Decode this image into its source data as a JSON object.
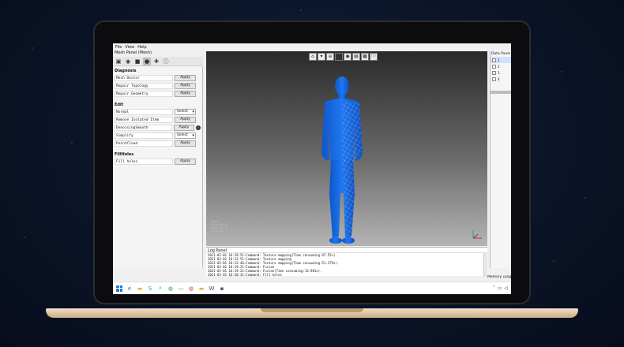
{
  "menubar": {
    "items": [
      "File",
      "View",
      "Help"
    ]
  },
  "left_panel": {
    "title": "Mesh Panel (Mesh)",
    "tools": [
      {
        "icon": "cube-icon",
        "active": false
      },
      {
        "icon": "eye-icon",
        "active": false
      },
      {
        "icon": "box-icon",
        "active": false
      },
      {
        "icon": "sphere-icon",
        "active": true
      },
      {
        "icon": "puzzle-icon",
        "active": false
      },
      {
        "icon": "info-icon",
        "active": false
      }
    ],
    "sections": [
      {
        "title": "Diagnosis",
        "rows": [
          {
            "label": "Mesh Doctor",
            "control": "button",
            "value": "Apply"
          },
          {
            "label": "Repair Topology",
            "control": "button",
            "value": "Apply"
          },
          {
            "label": "Repair Geometry",
            "control": "button",
            "value": "Apply"
          }
        ]
      },
      {
        "title": "Edit",
        "rows": [
          {
            "label": "Normal",
            "control": "select",
            "value": "Select"
          },
          {
            "label": "Remove Isolated Item",
            "control": "button",
            "value": "Apply"
          },
          {
            "label": "DenoisingSmooth",
            "control": "button",
            "value": "Apply",
            "info": true
          },
          {
            "label": "Simplify",
            "control": "select",
            "value": "Select"
          },
          {
            "label": "PointCloud",
            "control": "button",
            "value": "Apply"
          }
        ]
      },
      {
        "title": "FillHoles",
        "rows": [
          {
            "label": "Fill holes",
            "control": "button",
            "value": "Apply"
          }
        ]
      }
    ]
  },
  "viewport": {
    "toolbar": [
      {
        "icon": "home-icon"
      },
      {
        "icon": "arrow-down-icon"
      },
      {
        "icon": "layers-icon"
      },
      {
        "icon": "dark-square-icon"
      },
      {
        "icon": "eye-icon"
      },
      {
        "icon": "book-icon"
      },
      {
        "icon": "stack-icon"
      },
      {
        "icon": "info-icon"
      }
    ],
    "info_lines": [
      "Mesh0 :",
      "Faces 64 9K",
      "Verts 135 1K",
      "Textured"
    ]
  },
  "log_panel": {
    "title": "Log Panel",
    "lines": [
      "2021-02-01 16:19:51:Command: Texture mapping(Time consuming:47.55s).",
      "2021-02-01 16:12:51:Command: Texture mapping",
      "2021-02-01 16:12:46:Command: Texture mapping(Time consuming:51.279s).",
      "2021-02-01 16:19:21:Command: Fusion",
      "2021-02-01 16:19:21:Command: Fusion(Time consuming:13.981s).",
      "2021-02-01 16:20:31:Command: Fill holes"
    ]
  },
  "data_panel": {
    "title": "Data Panel",
    "rows": [
      {
        "label": "1",
        "selected": true
      },
      {
        "label": "2",
        "selected": false
      },
      {
        "label": "3",
        "selected": false
      },
      {
        "label": "4",
        "selected": false
      }
    ]
  },
  "status": {
    "memory": "Memory usage"
  },
  "taskbar": {
    "icons": [
      "windows-logo-icon",
      "edge-icon",
      "folder-icon",
      "skype-icon",
      "search-icon",
      "chrome-icon",
      "files-icon",
      "chrome-icon",
      "folder-icon",
      "word-icon",
      "app-icon"
    ],
    "tray": [
      "chevron-up-icon",
      "network-icon",
      "volume-icon"
    ]
  }
}
